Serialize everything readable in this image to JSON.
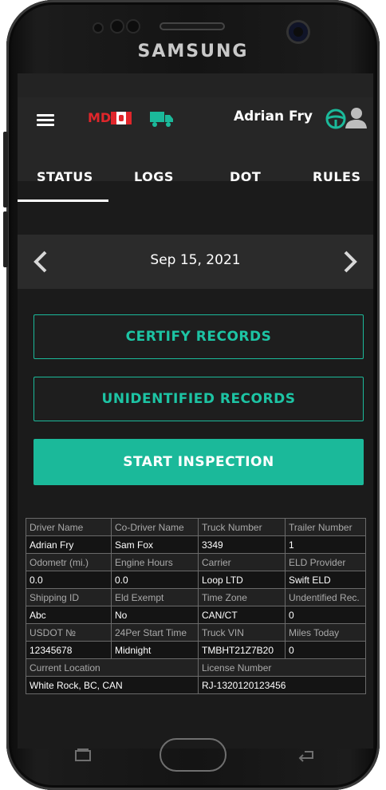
{
  "device": {
    "brand": "SAMSUNG"
  },
  "header": {
    "state_code": "MD",
    "driver_name": "Adrian Fry",
    "icons": {
      "menu": "menu-icon",
      "flag": "canada-flag-icon",
      "truck": "truck-icon",
      "wheel": "steering-wheel-icon",
      "person": "person-icon"
    },
    "colors": {
      "state_code": "#e0262b",
      "truck": "#1bb99a"
    }
  },
  "tabs": [
    {
      "label": "STATUS",
      "active": true
    },
    {
      "label": "LOGS"
    },
    {
      "label": "DOT"
    },
    {
      "label": "RULES"
    }
  ],
  "date_nav": {
    "date": "Sep 15, 2021",
    "prev_icon": "chevron-left-icon",
    "next_icon": "chevron-right-icon"
  },
  "actions": {
    "certify": "CERTIFY RECORDS",
    "unidentified": "UNIDENTIFIED RECORDS",
    "inspection": "START INSPECTION"
  },
  "accent_color": "#1bb99a",
  "info_table": [
    {
      "headers": [
        "Driver Name",
        "Co-Driver Name",
        "Truck Number",
        "Trailer Number"
      ],
      "values": [
        "Adrian Fry",
        "Sam Fox",
        "3349",
        "1"
      ]
    },
    {
      "headers": [
        "Odometr (mi.)",
        "Engine Hours",
        "Carrier",
        "ELD Provider"
      ],
      "values": [
        "0.0",
        "0.0",
        "Loop LTD",
        "Swift ELD"
      ]
    },
    {
      "headers": [
        "Shipping ID",
        "Eld Exempt",
        "Time Zone",
        "Undentified Rec."
      ],
      "values": [
        "Abc",
        "No",
        "CAN/CT",
        "0"
      ]
    },
    {
      "headers": [
        "USDOT №",
        "24Per Start Time",
        "Truck VIN",
        "Miles Today"
      ],
      "values": [
        "12345678",
        "Midnight",
        "TMBHT21Z7B20",
        "0"
      ]
    },
    {
      "headers": [
        "Current Location",
        "License Number"
      ],
      "values": [
        "White Rock, BC, CAN",
        "RJ-1320120123456"
      ]
    }
  ],
  "nav_icons": {
    "recent": "recent-apps-icon",
    "home": "home-button",
    "back": "back-icon"
  }
}
